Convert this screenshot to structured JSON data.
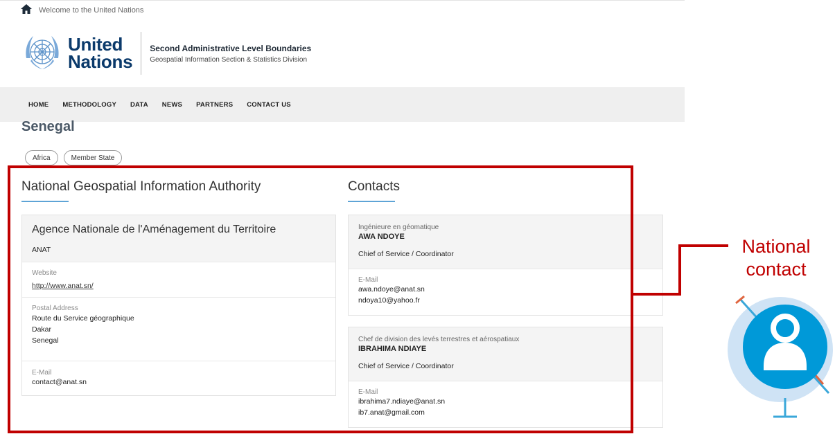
{
  "topbar": {
    "welcome": "Welcome to the United Nations",
    "home_icon": "home-icon"
  },
  "brand": {
    "line1": "United",
    "line2": "Nations",
    "title": "Second Administrative Level Boundaries",
    "subtitle": "Geospatial Information Section & Statistics Division",
    "logo_icon": "un-emblem-icon"
  },
  "nav": {
    "items": [
      "HOME",
      "METHODOLOGY",
      "DATA",
      "NEWS",
      "PARTNERS",
      "CONTACT US"
    ]
  },
  "country": {
    "name": "Senegal",
    "tags": [
      "Africa",
      "Member State"
    ]
  },
  "authority": {
    "heading": "National Geospatial Information Authority",
    "org_name": "Agence Nationale de l'Aménagement du Territoire",
    "org_abbr": "ANAT",
    "website_label": "Website",
    "website": "http://www.anat.sn/",
    "postal_label": "Postal Address",
    "postal_lines": [
      "Route du Service géographique",
      "Dakar",
      "Senegal"
    ],
    "email_label": "E-Mail",
    "email": "contact@anat.sn"
  },
  "contacts": {
    "heading": "Contacts",
    "people": [
      {
        "title": "Ingénieure en géomatique",
        "name": "AWA NDOYE",
        "role": "Chief of Service / Coordinator",
        "email_label": "E-Mail",
        "emails": [
          "awa.ndoye@anat.sn",
          "ndoya10@yahoo.fr"
        ]
      },
      {
        "title": "Chef de division des levés terrestres et aérospatiaux",
        "name": "IBRAHIMA NDIAYE",
        "role": "Chief of Service / Coordinator",
        "email_label": "E-Mail",
        "emails": [
          "ibrahima7.ndiaye@anat.sn",
          "ib7.anat@gmail.com"
        ]
      }
    ]
  },
  "callout": {
    "line1": "National",
    "line2": "contact",
    "color": "#c00000",
    "icon": "person-icon"
  },
  "colors": {
    "accent": "#5ea4d6",
    "highlight": "#c00000",
    "brand": "#0b3a6b",
    "person_icon": "#0099d8"
  }
}
